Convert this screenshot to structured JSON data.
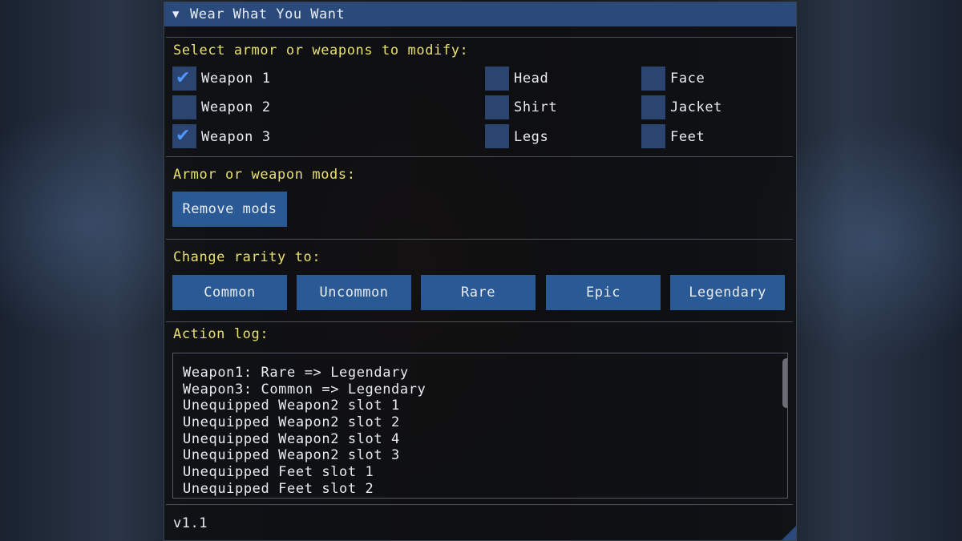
{
  "window": {
    "title": "Wear What You Want",
    "collapse_icon": "triangle-down-icon"
  },
  "select_section": {
    "label": "Select armor or weapons to modify:",
    "items": [
      {
        "label": "Weapon 1",
        "checked": true
      },
      {
        "label": "Weapon 2",
        "checked": false
      },
      {
        "label": "Weapon 3",
        "checked": true
      },
      {
        "label": "Head",
        "checked": false
      },
      {
        "label": "Shirt",
        "checked": false
      },
      {
        "label": "Legs",
        "checked": false
      },
      {
        "label": "Face",
        "checked": false
      },
      {
        "label": "Jacket",
        "checked": false
      },
      {
        "label": "Feet",
        "checked": false
      }
    ]
  },
  "mods_section": {
    "label": "Armor or weapon mods:",
    "remove_button": "Remove mods"
  },
  "rarity_section": {
    "label": "Change rarity to:",
    "buttons": [
      "Common",
      "Uncommon",
      "Rare",
      "Epic",
      "Legendary"
    ]
  },
  "log_section": {
    "label": "Action log:",
    "lines": [
      "Weapon1: Rare => Legendary",
      "Weapon3: Common => Legendary",
      "Unequipped Weapon2 slot 1",
      "Unequipped Weapon2 slot 2",
      "Unequipped Weapon2 slot 4",
      "Unequipped Weapon2 slot 3",
      "Unequipped Feet slot 1",
      "Unequipped Feet slot 2"
    ]
  },
  "footer": {
    "version": "v1.1"
  },
  "colors": {
    "title_bar": "#2a4a7c",
    "section_label": "#e8e070",
    "button": "#2a5a95",
    "checkbox": "#2b4470",
    "checkmark": "#4f96ff"
  }
}
